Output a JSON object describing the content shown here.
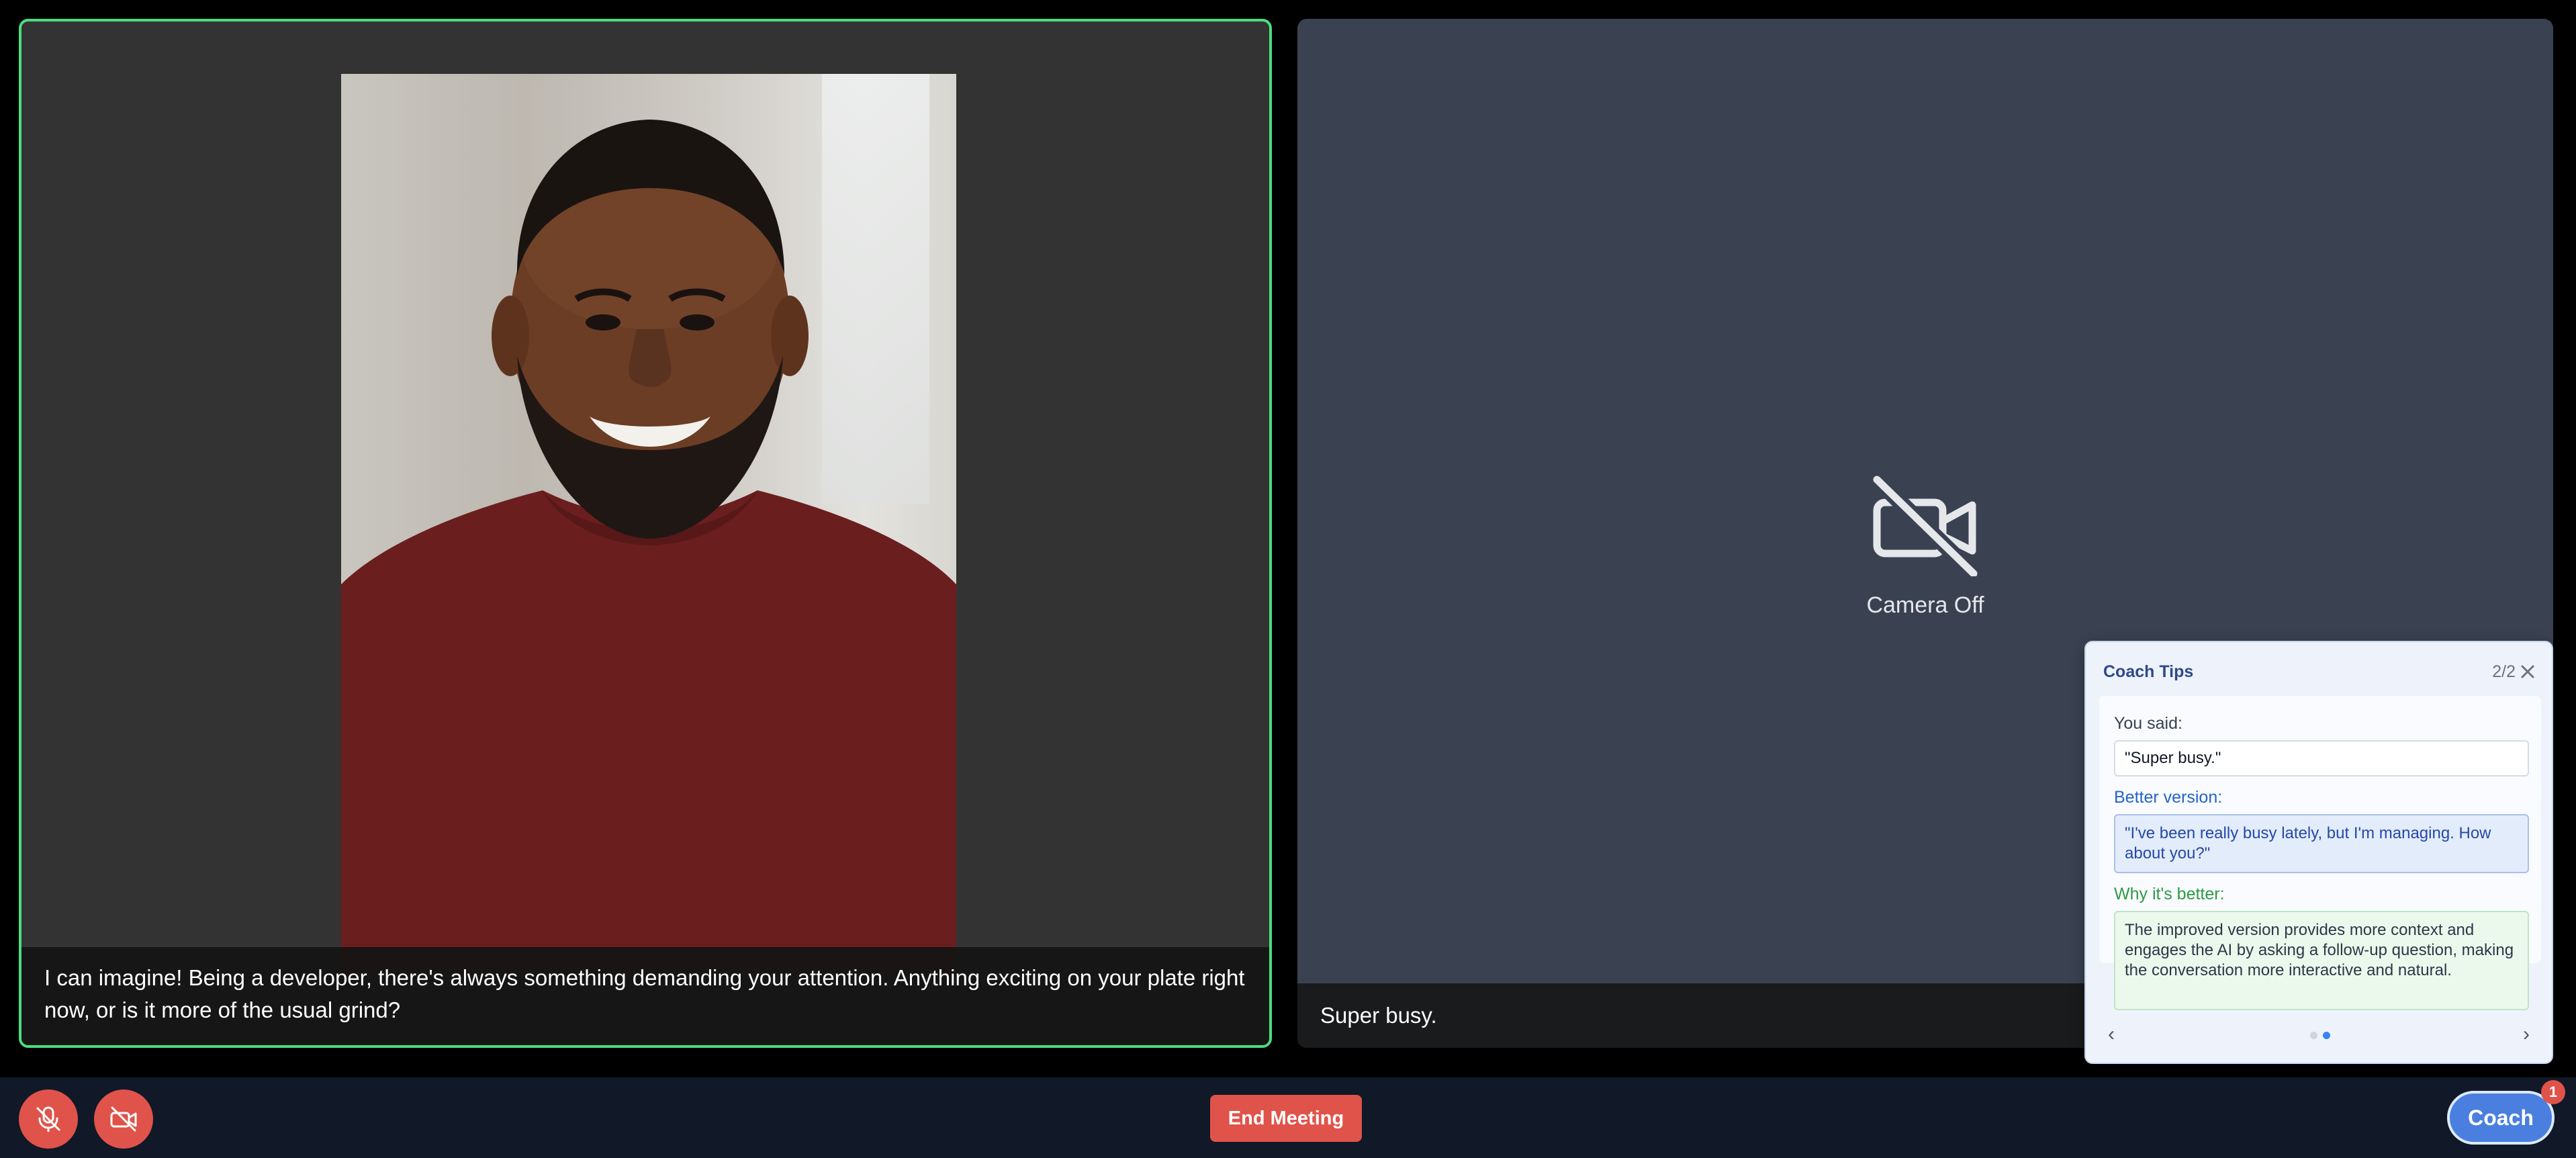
{
  "left_tile": {
    "caption": "I can imagine! Being a developer, there's always something demanding your attention. Anything exciting on your plate right now, or is it more of the usual grind?",
    "active_border_color": "#4ade80"
  },
  "right_tile": {
    "camera_off_label": "Camera Off",
    "caption": "Super busy."
  },
  "coach_tips": {
    "title": "Coach Tips",
    "counter": "2/2",
    "you_said_label": "You said:",
    "you_said": "\"Super busy.\"",
    "better_label": "Better version:",
    "better": "\"I've been really busy lately, but I'm managing. How about you?\"",
    "why_label": "Why it's better:",
    "why": "The improved version provides more context and engages the AI by asking a follow-up question, making the conversation more interactive and natural.",
    "prev_glyph": "‹",
    "next_glyph": "›",
    "dots": [
      "inactive",
      "active"
    ]
  },
  "controls": {
    "mic_icon": "mic-off-icon",
    "camera_icon": "camera-off-icon",
    "end_meeting_label": "End Meeting",
    "coach_label": "Coach",
    "coach_badge": "1"
  },
  "colors": {
    "danger": "#e0534a",
    "accent": "#4a7fe0",
    "tile_bg": "#3a4252"
  }
}
